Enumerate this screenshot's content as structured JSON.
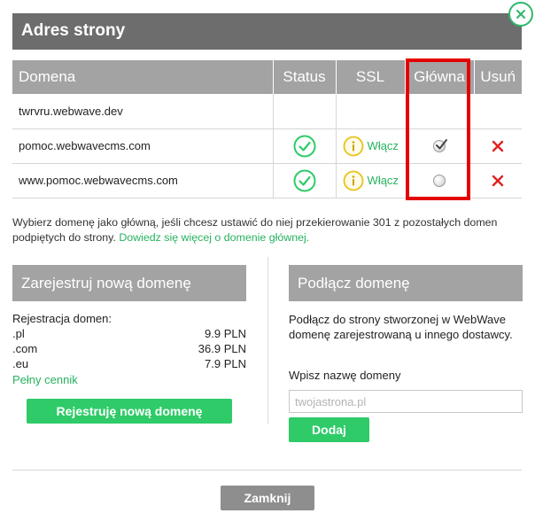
{
  "dialog": {
    "title": "Adres strony"
  },
  "table": {
    "headers": {
      "domain": "Domena",
      "status": "Status",
      "ssl": "SSL",
      "main": "Główna",
      "delete": "Usuń"
    },
    "rows": [
      {
        "domain": "twrvru.webwave.dev",
        "status_ok": false,
        "ssl_action": "",
        "main_selected": false,
        "deletable": false
      },
      {
        "domain": "pomoc.webwavecms.com",
        "status_ok": true,
        "ssl_action": "Włącz",
        "main_selected": true,
        "deletable": true
      },
      {
        "domain": "www.pomoc.webwavecms.com",
        "status_ok": true,
        "ssl_action": "Włącz",
        "main_selected": false,
        "deletable": true
      }
    ]
  },
  "info": {
    "text": "Wybierz domenę jako główną, jeśli chcesz ustawić do niej przekierowanie 301 z pozostałych domen podpiętych do strony. ",
    "link": "Dowiedz się więcej o domenie głównej."
  },
  "register": {
    "title": "Zarejestruj nową domenę",
    "label": "Rejestracja domen:",
    "prices": [
      {
        "tld": ".pl",
        "price": "9.9 PLN"
      },
      {
        "tld": ".com",
        "price": "36.9 PLN"
      },
      {
        "tld": ".eu",
        "price": "7.9 PLN"
      }
    ],
    "full_price_link": "Pełny cennik",
    "button": "Rejestruję nową domenę"
  },
  "connect": {
    "title": "Podłącz domenę",
    "description": "Podłącz do strony stworzonej w WebWave domenę zarejestrowaną u innego dostawcy.",
    "input_label": "Wpisz nazwę domeny",
    "input_placeholder": "twojastrona.pl",
    "button": "Dodaj"
  },
  "footer": {
    "close_button": "Zamknij"
  },
  "colors": {
    "accent_green": "#2ecb68",
    "link_green": "#27b15f",
    "header_gray": "#6d6d6d",
    "section_gray": "#a3a3a3",
    "highlight_red": "#e50000",
    "delete_red": "#e02020",
    "ssl_yellow": "#e8c21a"
  },
  "icons": {
    "close": "close-icon",
    "status": "check-circle-icon",
    "ssl": "info-circle-icon",
    "delete": "x-icon",
    "main_checked": "checked-radio-icon",
    "main_unchecked": "radio-icon"
  }
}
